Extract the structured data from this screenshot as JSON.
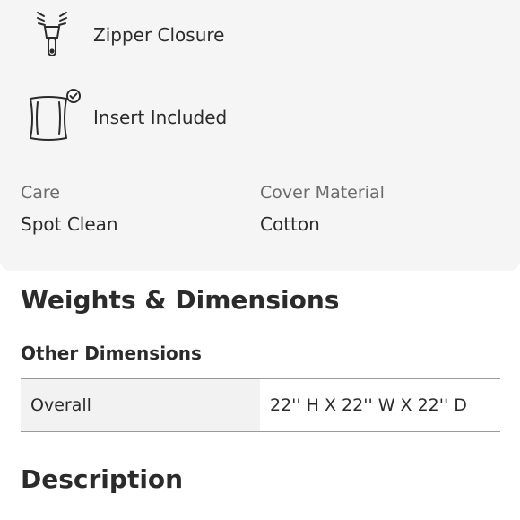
{
  "features": [
    {
      "icon": "zipper-icon",
      "label": "Zipper Closure"
    },
    {
      "icon": "pillow-insert-icon",
      "label": "Insert Included"
    }
  ],
  "specs": {
    "care": {
      "key": "Care",
      "value": "Spot Clean"
    },
    "cover_material": {
      "key": "Cover Material",
      "value": "Cotton"
    }
  },
  "weights_section": {
    "title": "Weights & Dimensions",
    "subtitle": "Other Dimensions",
    "rows": [
      {
        "label": "Overall",
        "value": "22'' H X 22'' W X 22'' D"
      }
    ]
  },
  "description_section": {
    "title": "Description"
  }
}
